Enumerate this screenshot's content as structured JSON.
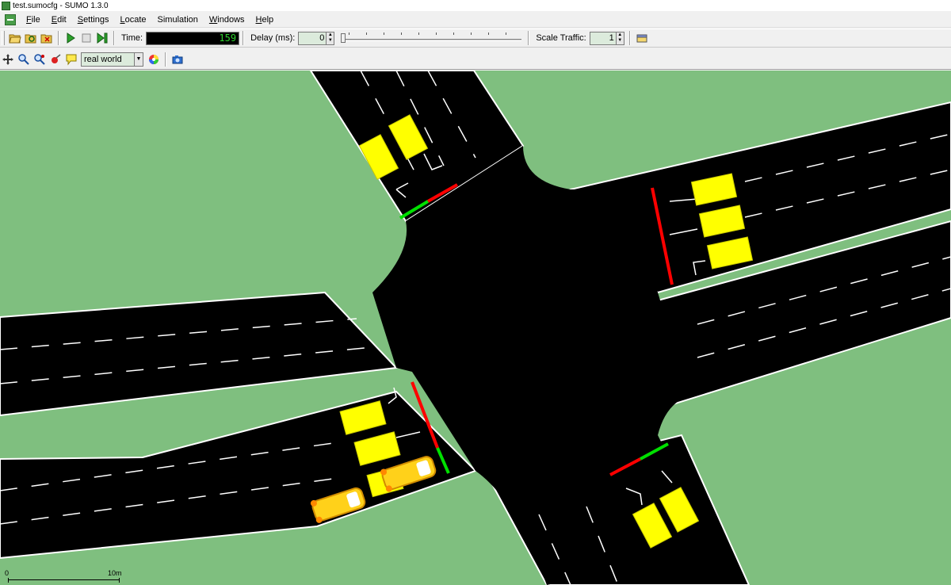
{
  "window": {
    "title": "test.sumocfg - SUMO 1.3.0"
  },
  "menu": [
    "File",
    "Edit",
    "Settings",
    "Locate",
    "Simulation",
    "Windows",
    "Help"
  ],
  "menu_underline": [
    "F",
    "E",
    "S",
    "L",
    "",
    "W",
    "H"
  ],
  "toolbar": {
    "time_label": "Time:",
    "time_value": "159",
    "delay_label": "Delay (ms):",
    "delay_value": "0",
    "scale_label": "Scale Traffic:",
    "scale_value": "1"
  },
  "viewbar": {
    "scheme": "real world"
  },
  "scale_bar": {
    "min_label": "0",
    "max_label": "10m"
  },
  "colors": {
    "grass": "#7fbf7f",
    "road": "#000000",
    "vehicle": "#ffff00",
    "signal_red": "#ff0000",
    "signal_green": "#00e000",
    "time_digits": "#2fd12f"
  },
  "icons": [
    "open-icon",
    "reload-icon",
    "close-icon",
    "play-icon",
    "stop-icon",
    "step-icon",
    "edit-icon",
    "recenter-icon",
    "zoom-icon",
    "locate-icon",
    "breakpoint-icon",
    "tooltip-icon",
    "color-wheel-icon",
    "screenshot-icon"
  ]
}
